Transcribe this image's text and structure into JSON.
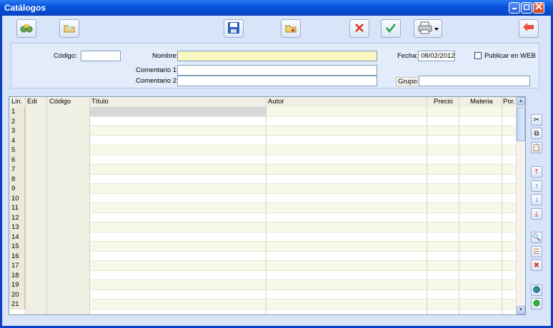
{
  "window": {
    "title": "Catálogos"
  },
  "form": {
    "codigo_label": "Código:",
    "codigo_value": "",
    "nombre_label": "Nombre:",
    "nombre_value": "",
    "fecha_label": "Fecha:",
    "fecha_value": "08/02/2012",
    "publicar_label": "Publicar en WEB",
    "publicar_checked": false,
    "comentario1_label": "Comentario 1:",
    "comentario1_value": "",
    "comentario2_label": "Comentario 2:",
    "comentario2_value": "",
    "grupo_label": "Grupo:",
    "grupo_value": ""
  },
  "grid": {
    "columns": [
      "Lin.",
      "Edi",
      "Código",
      "Título",
      "Autor",
      "Precio",
      "Materia",
      "Por."
    ],
    "rows": [
      "1",
      "2",
      "3",
      "4",
      "5",
      "6",
      "7",
      "8",
      "9",
      "10",
      "11",
      "12",
      "13",
      "14",
      "15",
      "16",
      "17",
      "18",
      "19",
      "20",
      "21"
    ]
  },
  "icons": {
    "toolbar": [
      "binoculars-icon",
      "open-folder-icon",
      "save-icon",
      "new-document-icon",
      "delete-icon",
      "accept-icon",
      "print-icon",
      "exit-icon"
    ],
    "side": [
      "cut-icon",
      "copy-icon",
      "paste-icon",
      "move-top-icon",
      "move-up-icon",
      "move-down-icon",
      "move-bottom-icon",
      "find-icon",
      "properties-icon",
      "delete-row-icon",
      "globe-icon",
      "status-icon"
    ]
  },
  "colors": {
    "titlebar": "#0846c8",
    "nombre_bg": "#f8f8c0",
    "accent_red": "#e03020",
    "accent_green": "#22a044"
  }
}
